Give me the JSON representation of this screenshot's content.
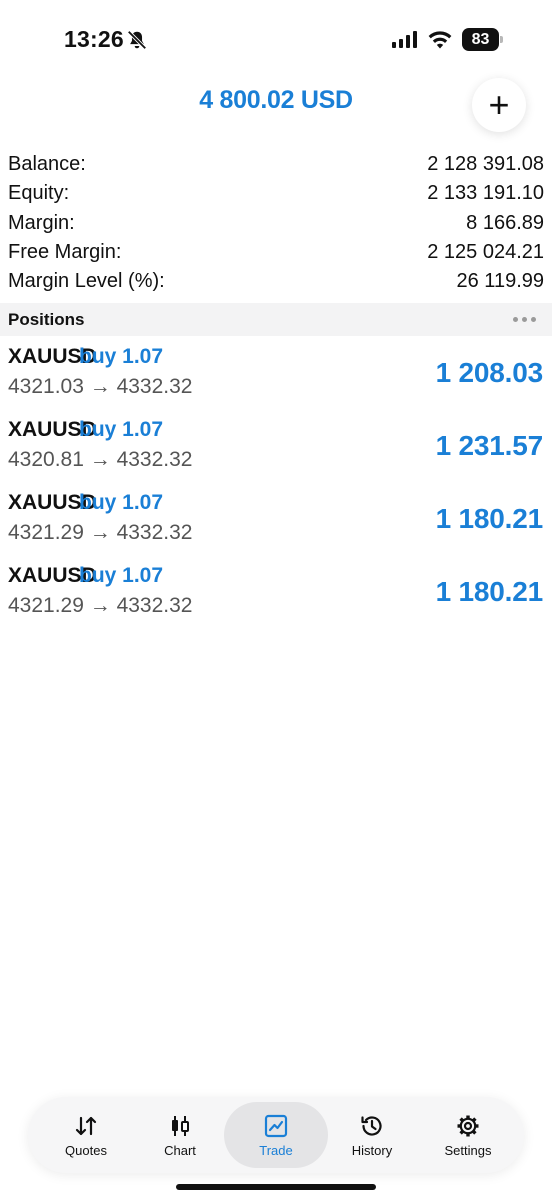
{
  "status_bar": {
    "time": "13:26",
    "battery": "83"
  },
  "header": {
    "title": "4 800.02 USD",
    "add_label": "+"
  },
  "account": [
    {
      "label": "Balance:",
      "value": "2 128 391.08"
    },
    {
      "label": "Equity:",
      "value": "2 133 191.10"
    },
    {
      "label": "Margin:",
      "value": "8 166.89"
    },
    {
      "label": "Free Margin:",
      "value": "2 125 024.21"
    },
    {
      "label": "Margin Level (%):",
      "value": "26 119.99"
    }
  ],
  "positions": {
    "title": "Positions",
    "items": [
      {
        "symbol": "XAUUSD",
        "side": "buy 1.07",
        "prices": "4321.03 → 4332.32",
        "profit": "1 208.03"
      },
      {
        "symbol": "XAUUSD",
        "side": "buy 1.07",
        "prices": "4320.81 → 4332.32",
        "profit": "1 231.57"
      },
      {
        "symbol": "XAUUSD",
        "side": "buy 1.07",
        "prices": "4321.29 → 4332.32",
        "profit": "1 180.21"
      },
      {
        "symbol": "XAUUSD",
        "side": "buy 1.07",
        "prices": "4321.29 → 4332.32",
        "profit": "1 180.21"
      }
    ]
  },
  "tabs": [
    {
      "label": "Quotes",
      "icon": "quotes-icon",
      "active": false
    },
    {
      "label": "Chart",
      "icon": "chart-icon",
      "active": false
    },
    {
      "label": "Trade",
      "icon": "trade-icon",
      "active": true
    },
    {
      "label": "History",
      "icon": "history-icon",
      "active": false
    },
    {
      "label": "Settings",
      "icon": "settings-icon",
      "active": false
    }
  ],
  "colors": {
    "accent": "#1a7fd6",
    "text": "#111111",
    "secondary_text": "#555555",
    "section_bg": "#f3f3f4"
  }
}
